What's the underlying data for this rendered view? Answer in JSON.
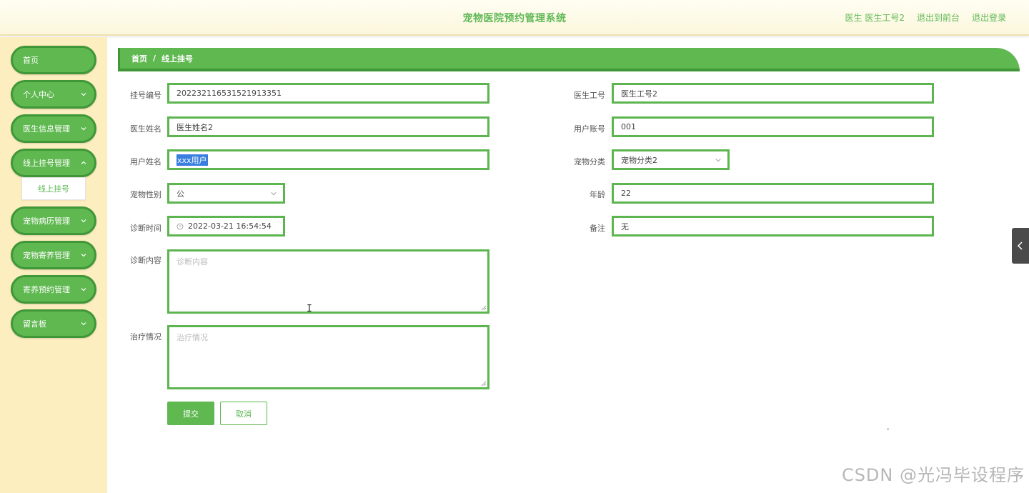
{
  "header": {
    "title": "宠物医院预约管理系统",
    "user_label": "医生 医生工号2",
    "back_label": "退出到前台",
    "logout_label": "退出登录"
  },
  "sidebar": {
    "items": [
      {
        "label": "首页"
      },
      {
        "label": "个人中心"
      },
      {
        "label": "医生信息管理"
      },
      {
        "label": "线上挂号管理"
      },
      {
        "label": "宠物病历管理"
      },
      {
        "label": "宠物寄养管理"
      },
      {
        "label": "寄养预约管理"
      },
      {
        "label": "留言板"
      }
    ],
    "submenu_label": "线上挂号"
  },
  "breadcrumb": {
    "home": "首页",
    "sep": "/",
    "current": "线上挂号"
  },
  "form": {
    "reg_no": {
      "label": "挂号编号",
      "value": "202232116531521913351"
    },
    "doctor_no": {
      "label": "医生工号",
      "value": "医生工号2"
    },
    "doctor_name": {
      "label": "医生姓名",
      "value": "医生姓名2"
    },
    "user_account": {
      "label": "用户账号",
      "value": "001"
    },
    "user_name": {
      "label": "用户姓名",
      "value": "xxx用户"
    },
    "pet_category": {
      "label": "宠物分类",
      "value": "宠物分类2"
    },
    "pet_gender": {
      "label": "宠物性别",
      "value": "公"
    },
    "age": {
      "label": "年龄",
      "value": "22"
    },
    "diag_time": {
      "label": "诊断时间",
      "value": "2022-03-21 16:54:54"
    },
    "remark": {
      "label": "备注",
      "value": "无"
    },
    "diag_content": {
      "label": "诊断内容",
      "placeholder": "诊断内容"
    },
    "treatment": {
      "label": "治疗情况",
      "placeholder": "治疗情况"
    },
    "submit_label": "提交",
    "cancel_label": "取消"
  },
  "watermark": "CSDN @光冯毕设程序",
  "colors": {
    "accent": "#5fb850",
    "accent_dark": "#3f9737",
    "sidebar_bg": "#fdeec0"
  }
}
